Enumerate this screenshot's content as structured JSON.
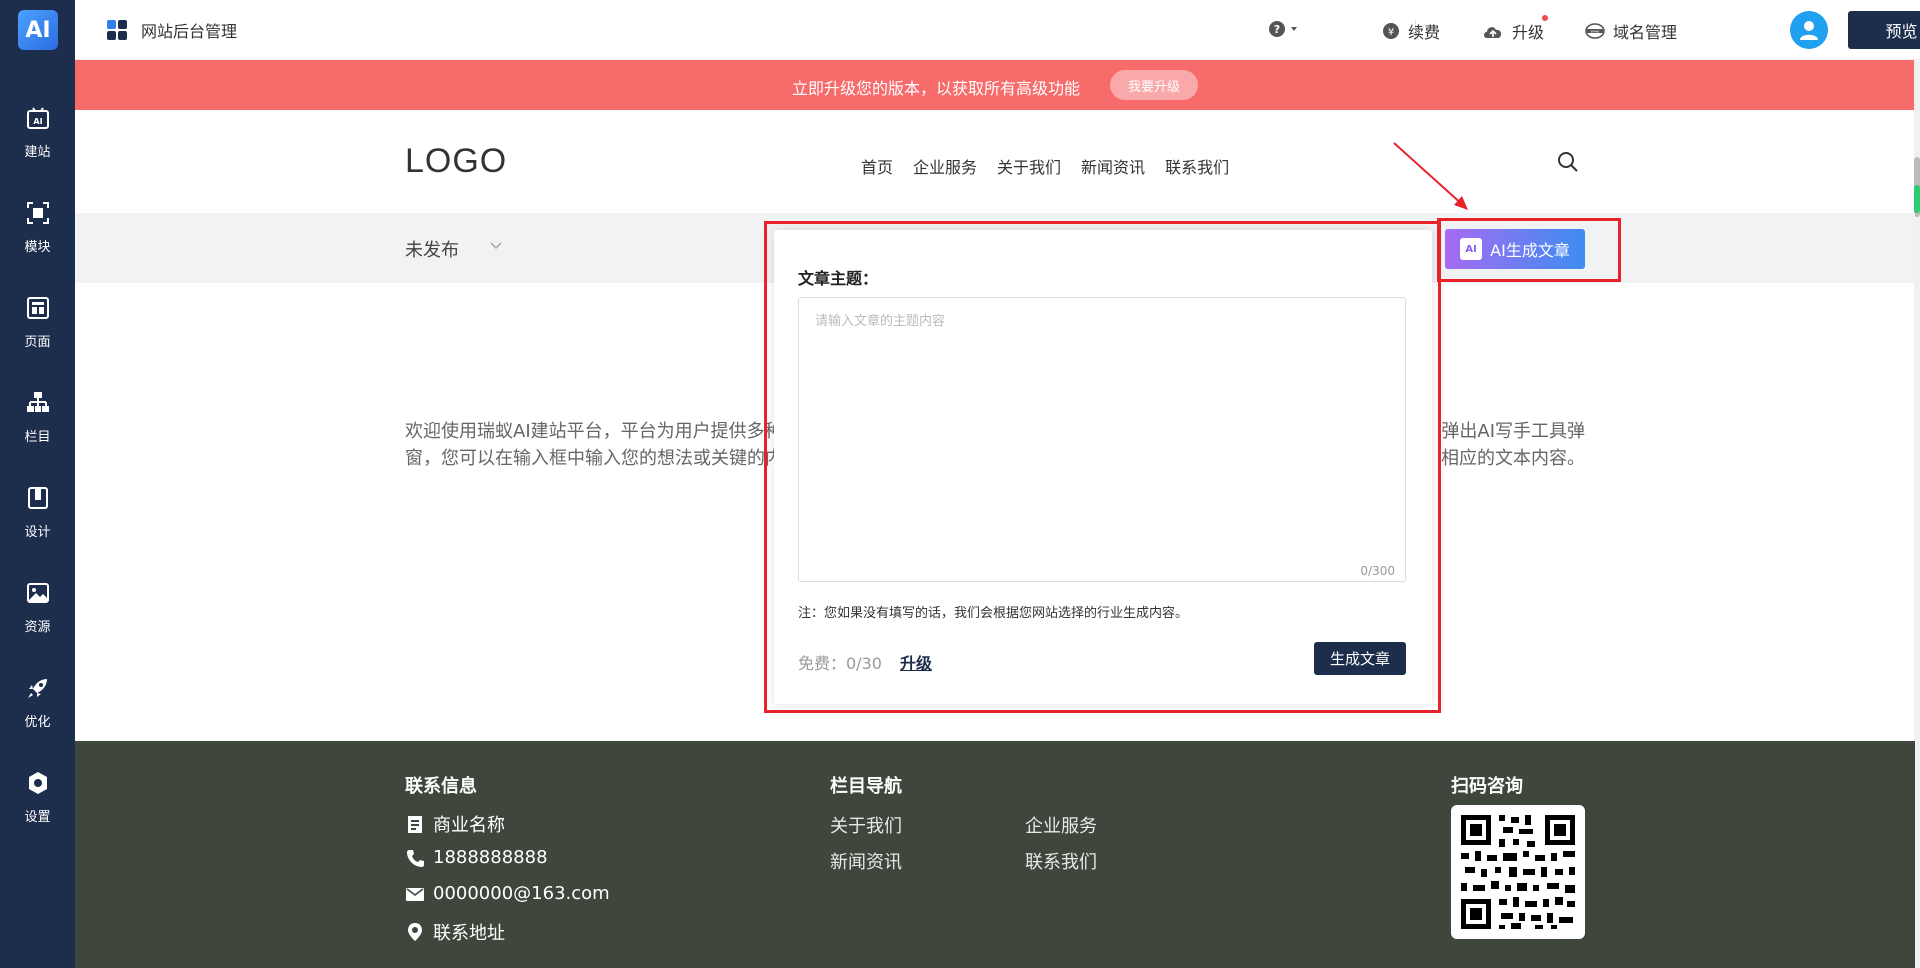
{
  "sidebar": {
    "brand": "AI",
    "items": [
      {
        "label": "建站",
        "icon": "ai-site-icon"
      },
      {
        "label": "模块",
        "icon": "module-icon"
      },
      {
        "label": "页面",
        "icon": "page-icon"
      },
      {
        "label": "栏目",
        "icon": "column-icon"
      },
      {
        "label": "设计",
        "icon": "design-icon"
      },
      {
        "label": "资源",
        "icon": "resource-icon"
      },
      {
        "label": "优化",
        "icon": "rocket-icon"
      },
      {
        "label": "设置",
        "icon": "settings-icon"
      }
    ]
  },
  "topbar": {
    "title": "网站后台管理",
    "help_icon": "help-icon",
    "renew_label": "续费",
    "upgrade_label": "升级",
    "domain_label": "域名管理",
    "preview_label": "预览"
  },
  "banner": {
    "text": "立即升级您的版本，以获取所有高级功能",
    "button": "我要升级"
  },
  "site": {
    "logo": "LOGO",
    "nav": [
      "首页",
      "企业服务",
      "关于我们",
      "新闻资讯",
      "联系我们"
    ]
  },
  "status": {
    "label": "未发布",
    "ai_button": "AI生成文章",
    "ai_icon_text": "AI"
  },
  "body": {
    "line1_left": "欢迎使用瑞蚁AI建站平台，平台为用户提供多种",
    "line1_right": "弹出AI写手工具弹",
    "line2_left": "窗，您可以在输入框中输入您的想法或关键的内",
    "line2_right": "相应的文本内容。"
  },
  "modal": {
    "label": "文章主题：",
    "placeholder": "请输入文章的主题内容",
    "counter": "0/300",
    "note": "注：您如果没有填写的话，我们会根据您网站选择的行业生成内容。",
    "free": "免费：0/30",
    "upgrade": "升级",
    "generate": "生成文章"
  },
  "footer": {
    "contact_heading": "联系信息",
    "company": "商业名称",
    "phone": "1888888888",
    "email": "0000000@163.com",
    "address": "联系地址",
    "nav_heading": "栏目导航",
    "links": [
      "关于我们",
      "企业服务",
      "新闻资讯",
      "联系我们"
    ],
    "qr_heading": "扫码咨询"
  },
  "colors": {
    "sidebar": "#1d2e4d",
    "banner": "#f76b6b",
    "footer": "#3f473d",
    "annotation": "#e8212a"
  }
}
